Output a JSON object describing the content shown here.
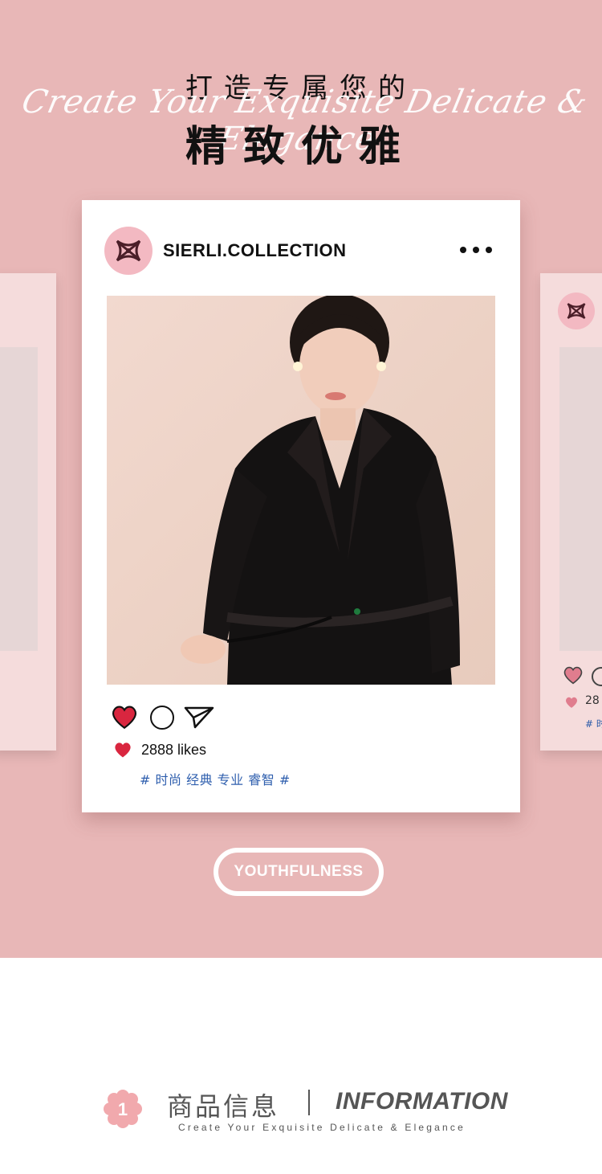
{
  "header": {
    "title_line1": "打造专属您的",
    "script_line": "Create Your Exquisite Delicate & Elegance",
    "title_line2": "精致优雅"
  },
  "post": {
    "account_name": "SIERLI.COLLECTION",
    "likes_text": "2888 likes",
    "tags": "# 时尚 经典 专业 睿智 #",
    "photo_subject": "woman-in-black-wrap-dress"
  },
  "side_card_right": {
    "likes_fragment": "28",
    "tag_fragment": "# 时"
  },
  "badge_button": {
    "label": "YOUTHFULNESS"
  },
  "info_section": {
    "number": "1",
    "title_cn": "商品信息",
    "title_en": "INFORMATION",
    "subtitle": "Create Your Exquisite Delicate & Elegance"
  },
  "colors": {
    "hero_bg": "#e8b7b7",
    "heart": "#d9263f",
    "tag_text": "#2f5fae",
    "avatar_bg": "#f3b9c2"
  },
  "icons": [
    "logo-icon",
    "more-options-icon",
    "heart-icon",
    "comment-icon",
    "send-icon",
    "flower-badge-icon"
  ]
}
